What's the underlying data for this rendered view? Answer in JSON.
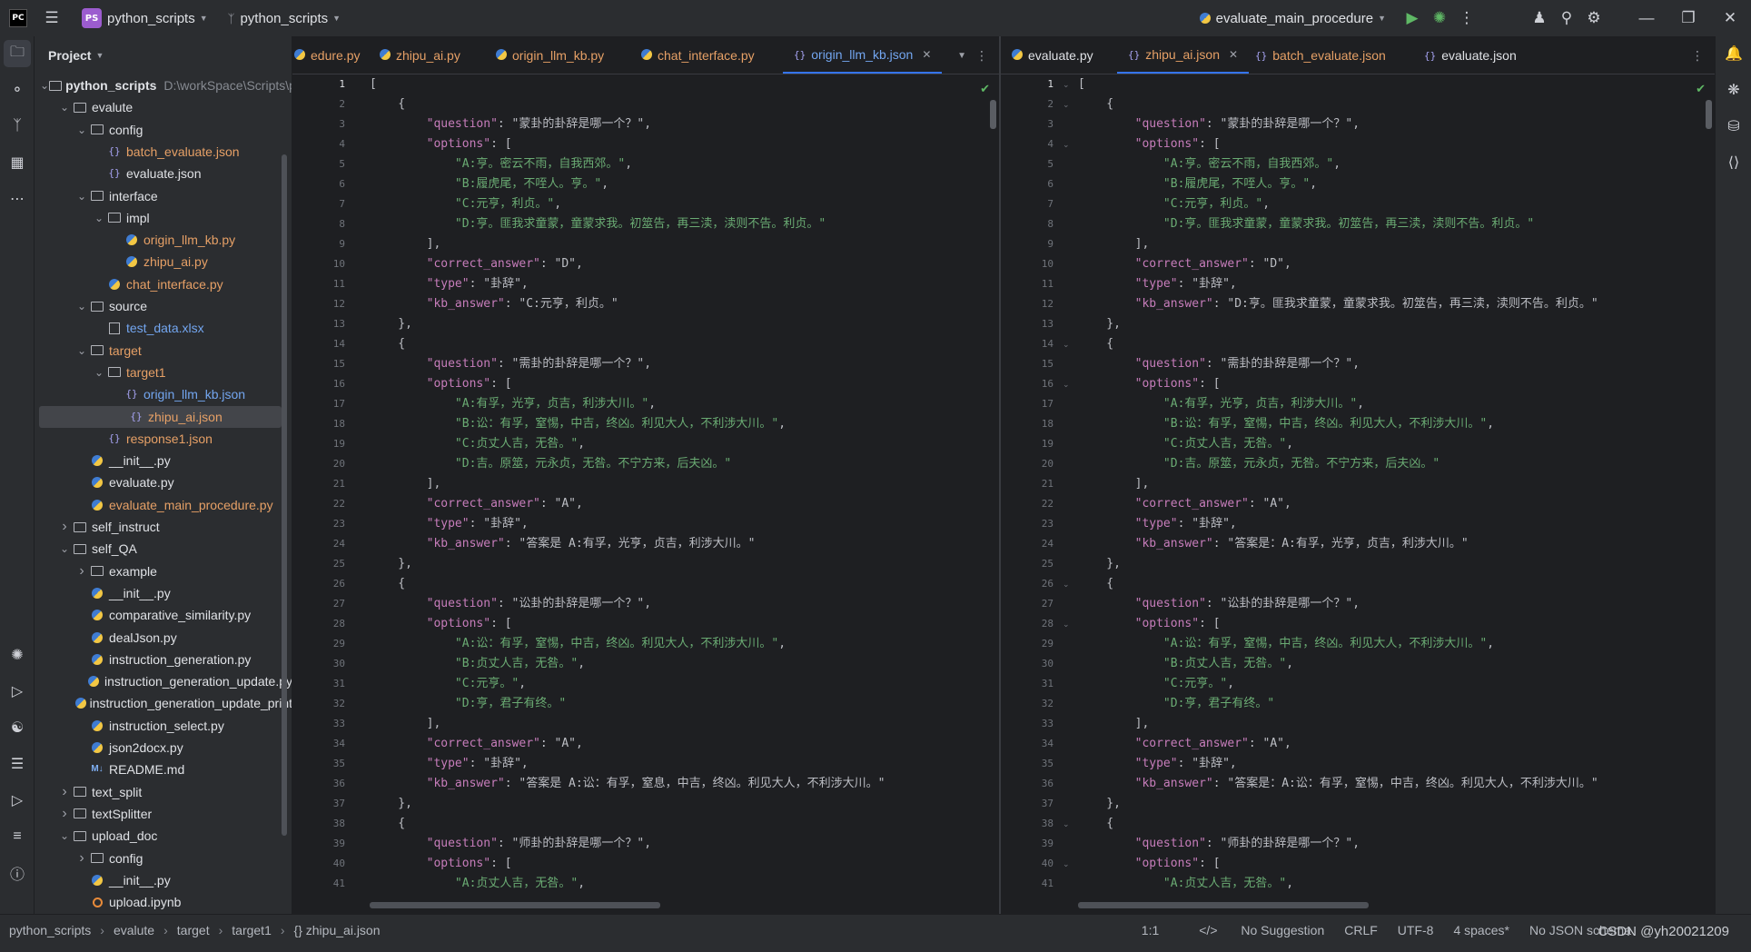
{
  "titlebar": {
    "project": "python_scripts",
    "branch": "python_scripts",
    "run_config": "evaluate_main_procedure",
    "badge": "PS"
  },
  "project_panel": {
    "title": "Project",
    "tree": [
      {
        "label": "python_scripts",
        "depth": 0,
        "type": "folder",
        "open": true,
        "bold": true,
        "color": "def",
        "extra": "D:\\workSpace\\Scripts\\pyt"
      },
      {
        "label": "evalute",
        "depth": 1,
        "type": "folder",
        "open": true,
        "color": "def"
      },
      {
        "label": "config",
        "depth": 2,
        "type": "folder",
        "open": true,
        "color": "def"
      },
      {
        "label": "batch_evaluate.json",
        "depth": 3,
        "type": "json",
        "color": "mod"
      },
      {
        "label": "evaluate.json",
        "depth": 3,
        "type": "json",
        "color": "def"
      },
      {
        "label": "interface",
        "depth": 2,
        "type": "folder",
        "open": true,
        "color": "def"
      },
      {
        "label": "impl",
        "depth": 3,
        "type": "folder",
        "open": true,
        "color": "def"
      },
      {
        "label": "origin_llm_kb.py",
        "depth": 4,
        "type": "py",
        "color": "mod"
      },
      {
        "label": "zhipu_ai.py",
        "depth": 4,
        "type": "py",
        "color": "mod"
      },
      {
        "label": "chat_interface.py",
        "depth": 3,
        "type": "py",
        "color": "mod"
      },
      {
        "label": "source",
        "depth": 2,
        "type": "folder",
        "open": true,
        "color": "def"
      },
      {
        "label": "test_data.xlsx",
        "depth": 3,
        "type": "xls",
        "color": "new"
      },
      {
        "label": "target",
        "depth": 2,
        "type": "folder",
        "open": true,
        "color": "mod"
      },
      {
        "label": "target1",
        "depth": 3,
        "type": "folder",
        "open": true,
        "color": "mod"
      },
      {
        "label": "origin_llm_kb.json",
        "depth": 4,
        "type": "json",
        "color": "new"
      },
      {
        "label": "zhipu_ai.json",
        "depth": 4,
        "type": "json",
        "color": "mod",
        "selected": true
      },
      {
        "label": "response1.json",
        "depth": 3,
        "type": "json",
        "color": "mod"
      },
      {
        "label": "__init__.py",
        "depth": 2,
        "type": "py",
        "color": "def"
      },
      {
        "label": "evaluate.py",
        "depth": 2,
        "type": "py",
        "color": "def"
      },
      {
        "label": "evaluate_main_procedure.py",
        "depth": 2,
        "type": "py",
        "color": "mod"
      },
      {
        "label": "self_instruct",
        "depth": 1,
        "type": "folder",
        "open": false,
        "color": "def"
      },
      {
        "label": "self_QA",
        "depth": 1,
        "type": "folder",
        "open": true,
        "color": "def"
      },
      {
        "label": "example",
        "depth": 2,
        "type": "folder",
        "open": false,
        "color": "def"
      },
      {
        "label": "__init__.py",
        "depth": 2,
        "type": "py",
        "color": "def"
      },
      {
        "label": "comparative_similarity.py",
        "depth": 2,
        "type": "py",
        "color": "def"
      },
      {
        "label": "dealJson.py",
        "depth": 2,
        "type": "py",
        "color": "def"
      },
      {
        "label": "instruction_generation.py",
        "depth": 2,
        "type": "py",
        "color": "def"
      },
      {
        "label": "instruction_generation_update.py",
        "depth": 2,
        "type": "py",
        "color": "def"
      },
      {
        "label": "instruction_generation_update_print",
        "depth": 2,
        "type": "py",
        "color": "def"
      },
      {
        "label": "instruction_select.py",
        "depth": 2,
        "type": "py",
        "color": "def"
      },
      {
        "label": "json2docx.py",
        "depth": 2,
        "type": "py",
        "color": "def"
      },
      {
        "label": "README.md",
        "depth": 2,
        "type": "md",
        "color": "def"
      },
      {
        "label": "text_split",
        "depth": 1,
        "type": "folder",
        "open": false,
        "color": "def"
      },
      {
        "label": "textSplitter",
        "depth": 1,
        "type": "folder",
        "open": false,
        "color": "def"
      },
      {
        "label": "upload_doc",
        "depth": 1,
        "type": "folder",
        "open": true,
        "color": "def"
      },
      {
        "label": "config",
        "depth": 2,
        "type": "folder",
        "open": false,
        "color": "def"
      },
      {
        "label": "__init__.py",
        "depth": 2,
        "type": "py",
        "color": "def"
      },
      {
        "label": "upload.ipynb",
        "depth": 2,
        "type": "nb",
        "color": "def"
      }
    ]
  },
  "left_editor": {
    "tabs": [
      {
        "label": "edure.py",
        "icon": "py",
        "color": "mod"
      },
      {
        "label": "zhipu_ai.py",
        "icon": "py",
        "color": "mod"
      },
      {
        "label": "origin_llm_kb.py",
        "icon": "py",
        "color": "mod"
      },
      {
        "label": "chat_interface.py",
        "icon": "py",
        "color": "mod"
      },
      {
        "label": "origin_llm_kb.json",
        "icon": "json",
        "color": "new",
        "active": true,
        "closable": true
      }
    ]
  },
  "right_editor": {
    "tabs": [
      {
        "label": "evaluate.py",
        "icon": "py",
        "color": "def"
      },
      {
        "label": "zhipu_ai.json",
        "icon": "json",
        "color": "mod",
        "active": true,
        "closable": true
      },
      {
        "label": "batch_evaluate.json",
        "icon": "json",
        "color": "mod"
      },
      {
        "label": "evaluate.json",
        "icon": "json",
        "color": "def"
      }
    ]
  },
  "left_code": [
    "[",
    "    {",
    "        \"question\": \"蒙卦的卦辞是哪一个？\",",
    "        \"options\": [",
    "            \"A:亨。密云不雨，自我西郊。\",",
    "            \"B:履虎尾，不咥人。亨。\",",
    "            \"C:元亨，利贞。\",",
    "            \"D:亨。匪我求童蒙，童蒙求我。初筮告，再三渎，渎则不告。利贞。\"",
    "        ],",
    "        \"correct_answer\": \"D\",",
    "        \"type\": \"卦辞\",",
    "        \"kb_answer\": \"C:元亨，利贞。\"",
    "    },",
    "    {",
    "        \"question\": \"需卦的卦辞是哪一个？\",",
    "        \"options\": [",
    "            \"A:有孚，光亨，贞吉，利涉大川。\",",
    "            \"B:讼：有孚，窒惕，中吉，终凶。利见大人，不利涉大川。\",",
    "            \"C:贞丈人吉，无咎。\",",
    "            \"D:吉。原筮，元永贞，无咎。不宁方来，后夫凶。\"",
    "        ],",
    "        \"correct_answer\": \"A\",",
    "        \"type\": \"卦辞\",",
    "        \"kb_answer\": \"答案是 A:有孚，光亨，贞吉，利涉大川。\"",
    "    },",
    "    {",
    "        \"question\": \"讼卦的卦辞是哪一个？\",",
    "        \"options\": [",
    "            \"A:讼：有孚，窒惕，中吉，终凶。利见大人，不利涉大川。\",",
    "            \"B:贞丈人吉，无咎。\",",
    "            \"C:元亨。\",",
    "            \"D:亨，君子有终。\"",
    "        ],",
    "        \"correct_answer\": \"A\",",
    "        \"type\": \"卦辞\",",
    "        \"kb_answer\": \"答案是 A:讼：有孚，窒息，中吉，终凶。利见大人，不利涉大川。\"",
    "    },",
    "    {",
    "        \"question\": \"师卦的卦辞是哪一个？\",",
    "        \"options\": [",
    "            \"A:贞丈人吉，无咎。\","
  ],
  "right_code": [
    "[",
    "    {",
    "        \"question\": \"蒙卦的卦辞是哪一个？\",",
    "        \"options\": [",
    "            \"A:亨。密云不雨，自我西郊。\",",
    "            \"B:履虎尾，不咥人。亨。\",",
    "            \"C:元亨，利贞。\",",
    "            \"D:亨。匪我求童蒙，童蒙求我。初筮告，再三渎，渎则不告。利贞。\"",
    "        ],",
    "        \"correct_answer\": \"D\",",
    "        \"type\": \"卦辞\",",
    "        \"kb_answer\": \"D:亨。匪我求童蒙，童蒙求我。初筮告，再三渎，渎则不告。利贞。\"",
    "    },",
    "    {",
    "        \"question\": \"需卦的卦辞是哪一个？\",",
    "        \"options\": [",
    "            \"A:有孚，光亨，贞吉，利涉大川。\",",
    "            \"B:讼：有孚，窒惕，中吉，终凶。利见大人，不利涉大川。\",",
    "            \"C:贞丈人吉，无咎。\",",
    "            \"D:吉。原筮，元永贞，无咎。不宁方来，后夫凶。\"",
    "        ],",
    "        \"correct_answer\": \"A\",",
    "        \"type\": \"卦辞\",",
    "        \"kb_answer\": \"答案是：A:有孚，光亨，贞吉，利涉大川。\"",
    "    },",
    "    {",
    "        \"question\": \"讼卦的卦辞是哪一个？\",",
    "        \"options\": [",
    "            \"A:讼：有孚，窒惕，中吉，终凶。利见大人，不利涉大川。\",",
    "            \"B:贞丈人吉，无咎。\",",
    "            \"C:元亨。\",",
    "            \"D:亨，君子有终。\"",
    "        ],",
    "        \"correct_answer\": \"A\",",
    "        \"type\": \"卦辞\",",
    "        \"kb_answer\": \"答案是：A:讼：有孚，窒惕，中吉，终凶。利见大人，不利涉大川。\"",
    "    },",
    "    {",
    "        \"question\": \"师卦的卦辞是哪一个？\",",
    "        \"options\": [",
    "            \"A:贞丈人吉，无咎。\","
  ],
  "statusbar": {
    "crumbs": [
      "python_scripts",
      "evalute",
      "target",
      "target1",
      "zhipu_ai.json"
    ],
    "position": "1:1",
    "suggestion": "No Suggestion",
    "line_sep": "CRLF",
    "encoding": "UTF-8",
    "indent": "4 spaces*",
    "schema": "No JSON schema"
  },
  "watermark": "CSDN @yh20021209"
}
